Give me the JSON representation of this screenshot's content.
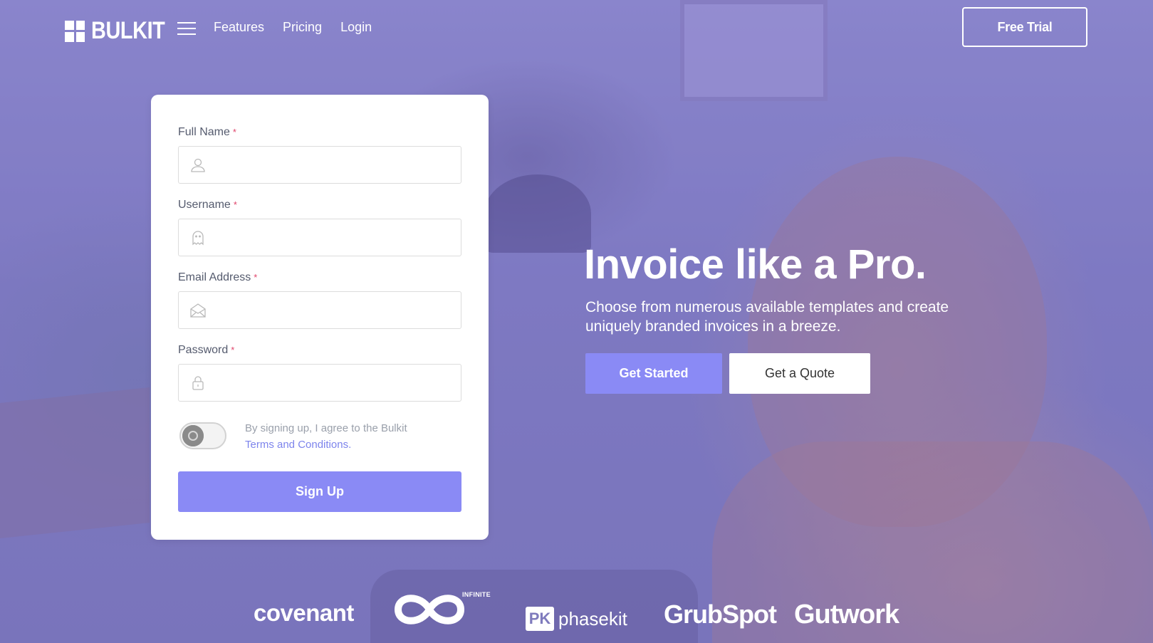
{
  "brand": {
    "name": "BULKIT"
  },
  "nav": {
    "links": [
      "Features",
      "Pricing",
      "Login"
    ],
    "cta_label": "Free Trial"
  },
  "form": {
    "fields": [
      {
        "label": "Full Name",
        "required_mark": "*",
        "icon": "user-icon",
        "value": "",
        "placeholder": ""
      },
      {
        "label": "Username",
        "required_mark": "*",
        "icon": "ghost-icon",
        "value": "",
        "placeholder": ""
      },
      {
        "label": "Email Address",
        "required_mark": "*",
        "icon": "envelope-icon",
        "value": "",
        "placeholder": ""
      },
      {
        "label": "Password",
        "required_mark": "*",
        "icon": "lock-icon",
        "value": "",
        "placeholder": ""
      }
    ],
    "terms": {
      "toggle_on": false,
      "text": "By signing up, I agree to the Bulkit",
      "link_text": "Terms and Conditions."
    },
    "submit_label": "Sign Up"
  },
  "hero": {
    "title": "Invoice like a Pro.",
    "subtitle": "Choose from numerous available templates and create uniquely branded invoices in a breeze.",
    "primary_label": "Get Started",
    "secondary_label": "Get a Quote"
  },
  "clients": {
    "logos": [
      "covenant",
      "INFINITE",
      "phasekit",
      "GrubSpot",
      "Gutwork"
    ],
    "phasekit_mark": "PK"
  },
  "colors": {
    "accent": "#8a8af5",
    "link": "#7d84ec",
    "required": "#e0456b",
    "overlay": "#7f7bbd"
  }
}
